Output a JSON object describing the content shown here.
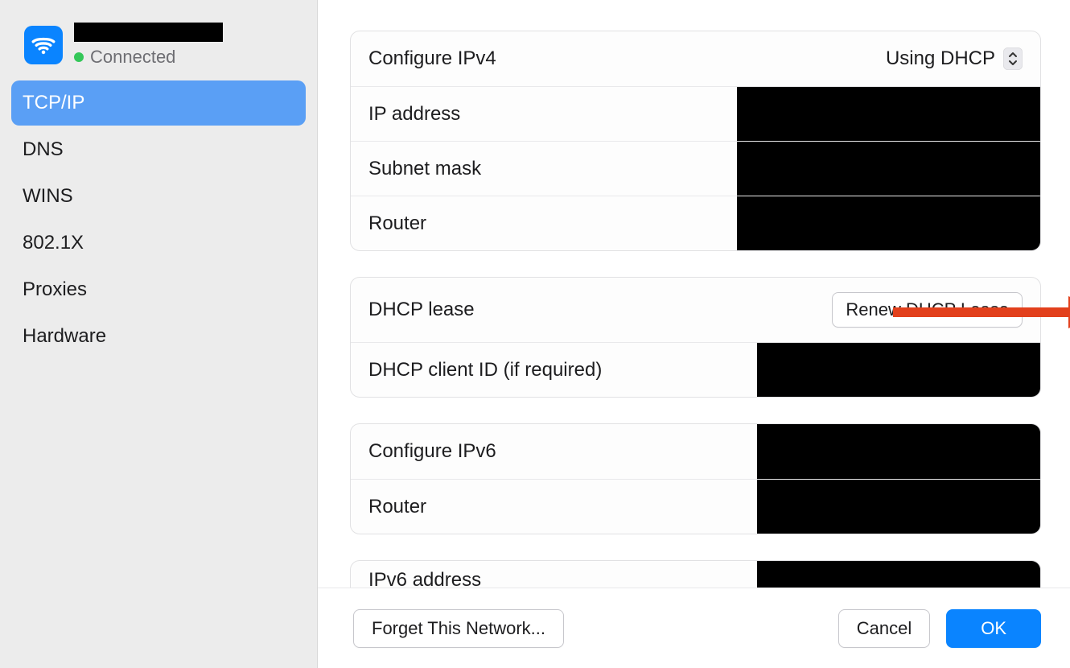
{
  "sidebar": {
    "status_label": "Connected",
    "items": [
      {
        "label": "TCP/IP"
      },
      {
        "label": "DNS"
      },
      {
        "label": "WINS"
      },
      {
        "label": "802.1X"
      },
      {
        "label": "Proxies"
      },
      {
        "label": "Hardware"
      }
    ],
    "selected_index": 0
  },
  "ipv4": {
    "configure_label": "Configure IPv4",
    "configure_value": "Using DHCP",
    "ip_label": "IP address",
    "subnet_label": "Subnet mask",
    "router_label": "Router"
  },
  "dhcp": {
    "lease_label": "DHCP lease",
    "renew_label": "Renew DHCP Lease",
    "client_id_label": "DHCP client ID (if required)"
  },
  "ipv6": {
    "configure_label": "Configure IPv6",
    "router_label": "Router",
    "address_label": "IPv6 address"
  },
  "footer": {
    "forget_label": "Forget This Network...",
    "cancel_label": "Cancel",
    "ok_label": "OK"
  }
}
